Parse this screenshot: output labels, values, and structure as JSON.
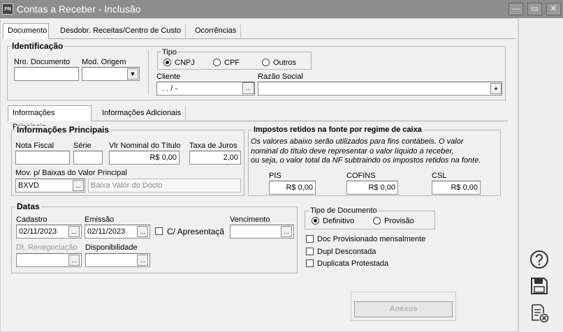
{
  "window": {
    "app_icon": "FN",
    "title": "Contas a Receber - Inclusão",
    "minimize": "—",
    "maximize": "▭",
    "close": "✕"
  },
  "tabs": [
    "Documento",
    "Desdobr. Receitas/Centro de Custo",
    "Ocorrências"
  ],
  "identificacao": {
    "legend": "Identificação",
    "nro_documento": {
      "label": "Nro. Documento",
      "value": ""
    },
    "mod_origem": {
      "label": "Mod. Origem",
      "value": ""
    },
    "tipo": {
      "label": "Tipo",
      "options": [
        "CNPJ",
        "CPF",
        "Outros"
      ],
      "selected": "CNPJ"
    },
    "cliente": {
      "label": "Cliente",
      "value": ". . / -",
      "button": "..."
    },
    "razao_social": {
      "label": "Razão Social",
      "value": "",
      "button": "+"
    }
  },
  "subtabs": [
    "Informações Principais",
    "Informações Adicionais"
  ],
  "info_principais": {
    "legend": "Informações Principais",
    "nota_fiscal": {
      "label": "Nota Fiscal",
      "value": ""
    },
    "serie": {
      "label": "Série",
      "value": ""
    },
    "vlr_nominal": {
      "label": "Vlr Nominal do Título",
      "value": "R$ 0,00"
    },
    "taxa_juros": {
      "label": "Taxa de Juros",
      "value": "2,00"
    },
    "mov_baixas": {
      "label": "Mov. p/ Baixas do Valor Principal",
      "code": "BXVD",
      "button": "...",
      "description": "Baixa Valor do Docto"
    }
  },
  "impostos": {
    "legend": "Impostos retidos na fonte por regime de caixa",
    "note_lines": [
      "Os valores abaixo serão utilizados para fins contábeis. O valor",
      "nominal do título deve representar o valor líquido a receber,",
      "ou seja, o valor total da NF subtraindo os impostos retidos na fonte."
    ],
    "pis": {
      "label": "PIS",
      "value": "R$ 0,00"
    },
    "cofins": {
      "label": "COFINS",
      "value": "R$ 0,00"
    },
    "csl": {
      "label": "CSL",
      "value": "R$ 0,00"
    }
  },
  "datas": {
    "legend": "Datas",
    "cadastro": {
      "label": "Cadastro",
      "value": "02/11/2023",
      "button": "..."
    },
    "emissao": {
      "label": "Emissão",
      "value": "02/11/2023",
      "button": "..."
    },
    "c_apresentacao": {
      "label": "C/ Apresentaçã",
      "checked": false
    },
    "vencimento": {
      "label": "Vencimento",
      "value": "",
      "button": "..."
    },
    "dt_renegociacao": {
      "label": "Dt. Renegociação",
      "value": "",
      "button": "..."
    },
    "disponibilidade": {
      "label": "Disponibilidade",
      "value": "",
      "button": "..."
    }
  },
  "tipo_documento": {
    "legend": "Tipo de Documento",
    "options": [
      "Definitivo",
      "Provisão"
    ],
    "selected": "Definitivo"
  },
  "checkboxes": [
    {
      "label": "Doc Provisionado mensalmente",
      "checked": false
    },
    {
      "label": "Dupl Descontada",
      "checked": false
    },
    {
      "label": "Duplicata Protestada",
      "checked": false
    }
  ],
  "anexos_button": "Anexos",
  "side_icons": [
    "help-icon",
    "save-icon",
    "cancel-document-icon"
  ]
}
